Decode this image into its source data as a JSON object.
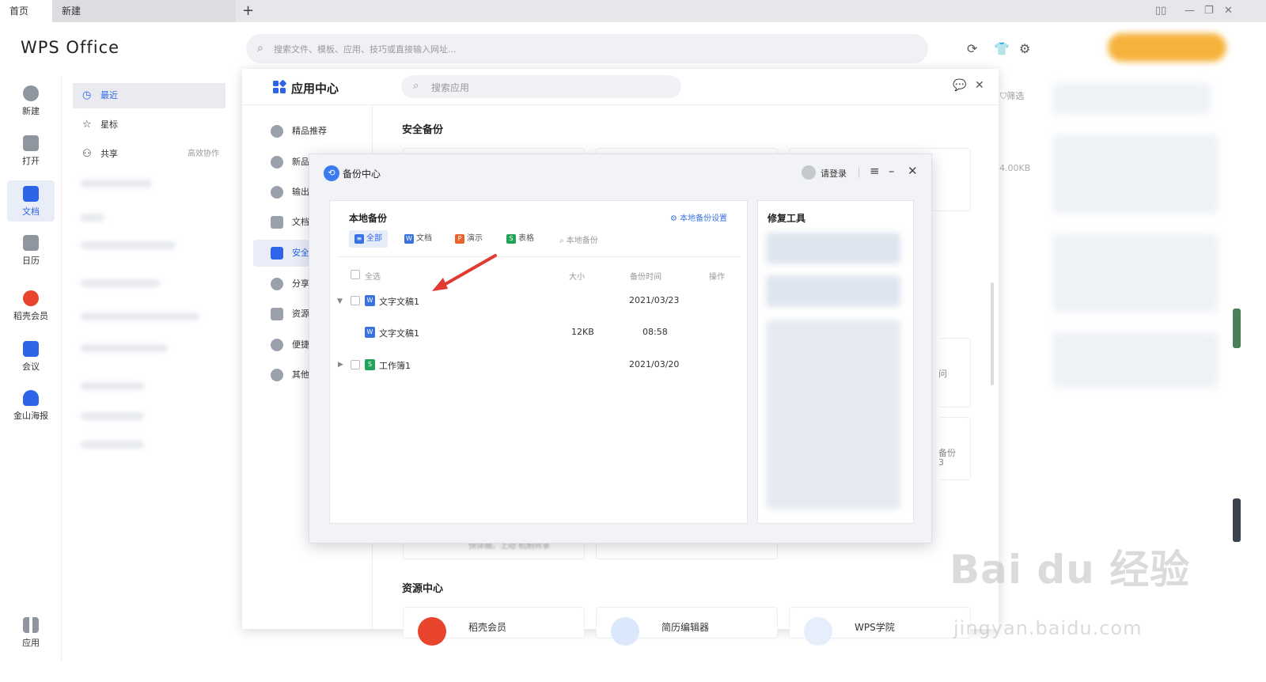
{
  "tabs": {
    "home": "首页",
    "new": "新建",
    "add": "+"
  },
  "window": {
    "icons": [
      "layout-icon",
      "minimize-icon",
      "restore-icon",
      "close-icon"
    ]
  },
  "header": {
    "logo": "WPS Office",
    "search_placeholder": "搜索文件、模板、应用、技巧或直接输入网址..."
  },
  "leftnav": [
    {
      "label": "新建",
      "icon": "plus-circle-icon",
      "color": "#8a8f99"
    },
    {
      "label": "打开",
      "icon": "folder-icon",
      "color": "#8a8f99"
    },
    {
      "label": "文档",
      "icon": "document-icon",
      "color": "#2d64e8"
    },
    {
      "label": "日历",
      "icon": "calendar-icon",
      "color": "#8a8f99"
    },
    {
      "label": "稻壳会员",
      "icon": "docer-icon",
      "color": "#e8452c"
    },
    {
      "label": "会议",
      "icon": "meeting-icon",
      "color": "#2d64e8"
    },
    {
      "label": "金山海报",
      "icon": "poster-icon",
      "color": "#2d64e8"
    },
    {
      "label": "应用",
      "icon": "apps-grid-icon",
      "color": "#8a8f99"
    }
  ],
  "filecol": {
    "recent": "最近",
    "starred": "星标",
    "shared": "共享",
    "shared_extra": "高效协作"
  },
  "background": {
    "filter": "筛选",
    "size": "4.00KB",
    "frag1": "问",
    "frag2": "备份",
    "frag3": "3"
  },
  "appcenter": {
    "title": "应用中心",
    "search_placeholder": "搜索应用",
    "side": [
      "精品推荐",
      "新品",
      "输出",
      "文档",
      "安全",
      "分享",
      "资源",
      "便捷",
      "其他"
    ],
    "section_backup": "安全备份",
    "section_resource": "资源中心",
    "resource_cards": [
      "稻壳会员",
      "简历编辑器",
      "WPS学院"
    ],
    "card_hint": "快详细，上动 机制共享"
  },
  "backup": {
    "title": "备份中心",
    "login": "请登录",
    "panel_title": "本地备份",
    "settings": "本地备份设置",
    "filters": [
      {
        "label": "全部",
        "badge": "≡",
        "color": "#3a73e0"
      },
      {
        "label": "文档",
        "badge": "W",
        "color": "#3a73e0"
      },
      {
        "label": "演示",
        "badge": "P",
        "color": "#e8632c"
      },
      {
        "label": "表格",
        "badge": "S",
        "color": "#22a35a"
      }
    ],
    "search_placeholder": "本地备份",
    "headers": {
      "select_all": "全选",
      "size": "大小",
      "time": "备份时间",
      "action": "操作"
    },
    "rows": [
      {
        "name": "文字文稿1",
        "size": "",
        "time": "2021/03/23",
        "badge": "W",
        "color": "#3a73e0"
      },
      {
        "name": "文字文稿1",
        "size": "12KB",
        "time": "08:58",
        "badge": "W",
        "color": "#3a73e0"
      },
      {
        "name": "工作簿1",
        "size": "",
        "time": "2021/03/20",
        "badge": "S",
        "color": "#22a35a"
      }
    ],
    "repair_title": "修复工具"
  },
  "watermark": {
    "main": "Bai du 经验",
    "url": "jingyan.baidu.com"
  },
  "colors": {
    "accent": "#2d64e8",
    "arrow": "#e03a32"
  }
}
